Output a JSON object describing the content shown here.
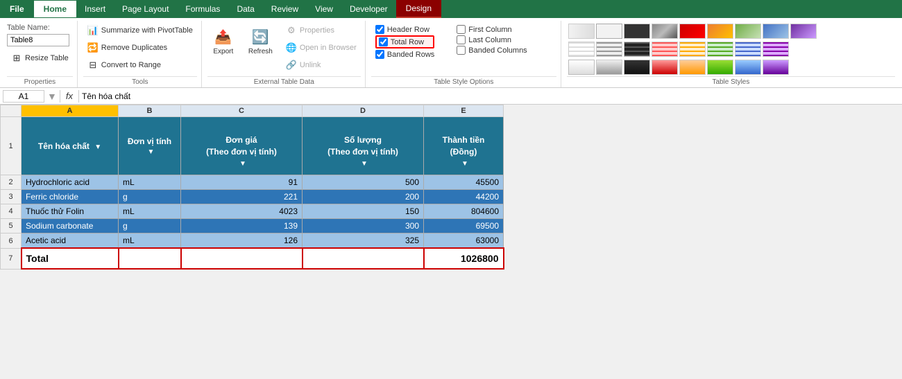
{
  "tabs": {
    "file": "File",
    "home": "Home",
    "insert": "Insert",
    "page_layout": "Page Layout",
    "formulas": "Formulas",
    "data": "Data",
    "review": "Review",
    "view": "View",
    "developer": "Developer",
    "design": "Design"
  },
  "groups": {
    "properties": {
      "label": "Properties",
      "table_name_label": "Table Name:",
      "table_name_value": "Table8",
      "resize_label": "Resize Table"
    },
    "tools": {
      "label": "Tools",
      "summarize_label": "Summarize with PivotTable",
      "remove_dup_label": "Remove Duplicates",
      "convert_label": "Convert to Range"
    },
    "external": {
      "label": "External Table Data",
      "export_label": "Export",
      "refresh_label": "Refresh",
      "properties_label": "Properties",
      "open_browser_label": "Open in Browser",
      "unlink_label": "Unlink"
    },
    "style_options": {
      "label": "Table Style Options",
      "header_row": "Header Row",
      "total_row": "Total Row",
      "banded_rows": "Banded Rows",
      "first_column": "First Column",
      "last_column": "Last Column",
      "banded_columns": "Banded Columns",
      "header_row_checked": true,
      "total_row_checked": true,
      "banded_rows_checked": true,
      "first_column_checked": false,
      "last_column_checked": false,
      "banded_columns_checked": false
    },
    "table_styles": {
      "label": "Table Styles"
    }
  },
  "formula_bar": {
    "cell_ref": "A1",
    "formula": "Tên hóa chất"
  },
  "columns": {
    "headers": [
      "A",
      "B",
      "C",
      "D",
      "E"
    ],
    "row_numbers": [
      "1",
      "2",
      "3",
      "4",
      "5",
      "6",
      "7"
    ]
  },
  "table": {
    "headers": [
      "Tên hóa chất",
      "Đơn vị tính",
      "Đơn giá\n(Theo đơn vị tính)",
      "Số lượng\n(Theo đơn vị tính)",
      "Thành tiền\n(Đồng)"
    ],
    "rows": [
      [
        "Hydrochloric acid",
        "mL",
        "91",
        "500",
        "45500"
      ],
      [
        "Ferric chloride",
        "g",
        "221",
        "200",
        "44200"
      ],
      [
        "Thuốc thử Folin",
        "mL",
        "4023",
        "150",
        "804600"
      ],
      [
        "Sodium carbonate",
        "g",
        "139",
        "300",
        "69500"
      ],
      [
        "Acetic acid",
        "mL",
        "126",
        "325",
        "63000"
      ]
    ],
    "total_row": [
      "Total",
      "",
      "",
      "",
      "1026800"
    ]
  }
}
